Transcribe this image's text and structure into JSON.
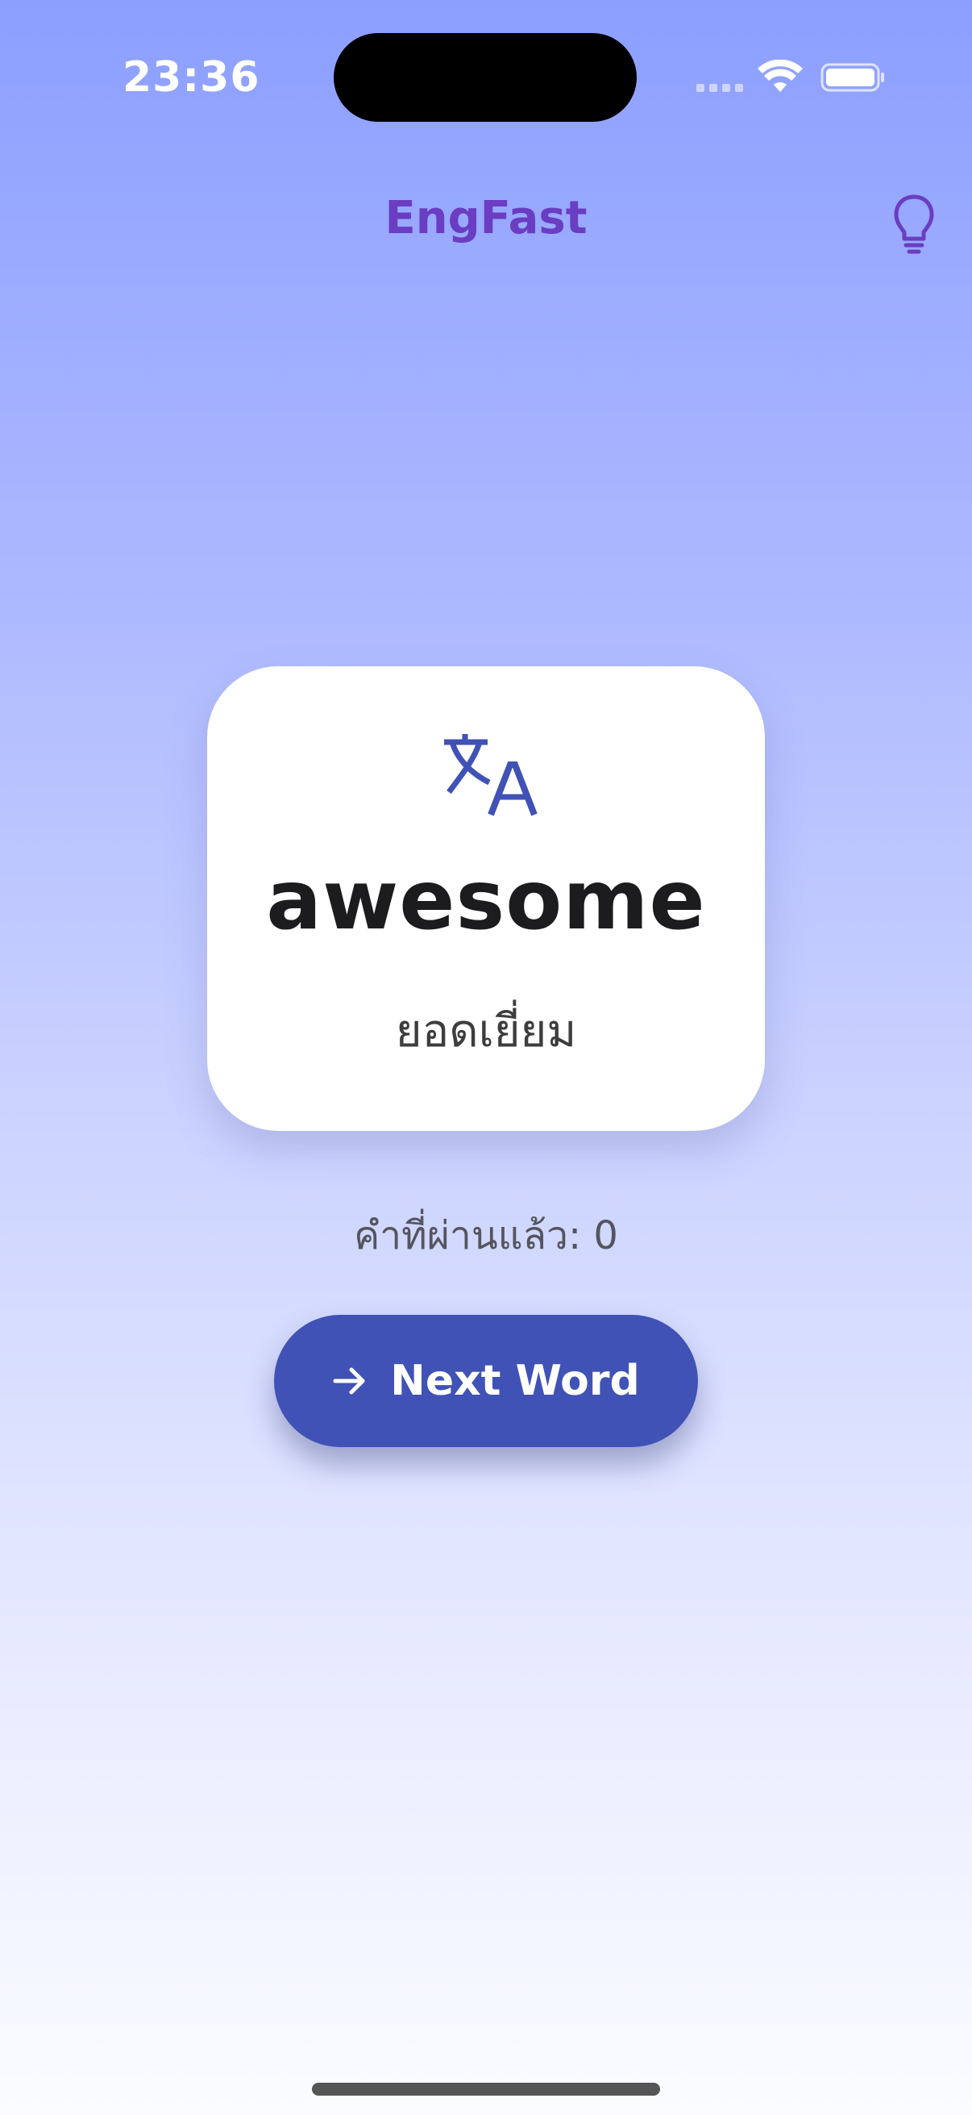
{
  "status_bar": {
    "time": "23:36"
  },
  "header": {
    "title": "EngFast",
    "hint_icon": "lightbulb-icon"
  },
  "card": {
    "icon": "translate-icon",
    "word": "awesome",
    "translation": "ยอดเยี่ยม"
  },
  "progress": {
    "text": "คำที่ผ่านแล้ว: 0"
  },
  "next_button": {
    "icon": "arrow-right-icon",
    "label": "Next Word"
  },
  "colors": {
    "accent_title": "#6a3dc2",
    "button_bg": "#4052b5",
    "icon_blue": "#4052b5"
  }
}
